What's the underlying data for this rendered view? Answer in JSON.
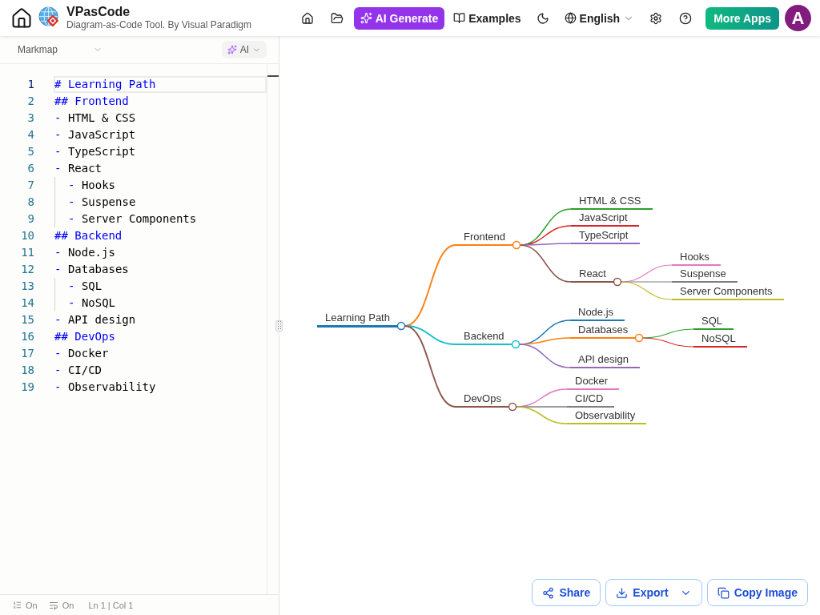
{
  "header": {
    "app_name": "VPasCode",
    "tagline": "Diagram-as-Code Tool. By Visual Paradigm",
    "ai_generate": "AI Generate",
    "examples": "Examples",
    "language": "English",
    "more_apps": "More Apps",
    "avatar": "A"
  },
  "editor": {
    "diagram_type": "Markmap",
    "ai_menu": "AI",
    "lines": [
      {
        "number": "1",
        "kind": "heading",
        "marker": "#",
        "text": "Learning Path",
        "selected": true
      },
      {
        "number": "2",
        "kind": "heading",
        "marker": "##",
        "text": "Frontend",
        "selected": false
      },
      {
        "number": "3",
        "kind": "item",
        "marker": "-",
        "text": "HTML & CSS",
        "selected": false
      },
      {
        "number": "4",
        "kind": "item",
        "marker": "-",
        "text": "JavaScript",
        "selected": false
      },
      {
        "number": "5",
        "kind": "item",
        "marker": "-",
        "text": "TypeScript",
        "selected": false
      },
      {
        "number": "6",
        "kind": "item",
        "marker": "-",
        "text": "React",
        "selected": false,
        "children": [
          {
            "number": "7",
            "kind": "item",
            "marker": "-",
            "text": "Hooks",
            "selected": false
          },
          {
            "number": "8",
            "kind": "item",
            "marker": "-",
            "text": "Suspense",
            "selected": false
          },
          {
            "number": "9",
            "kind": "item",
            "marker": "-",
            "text": "Server Components",
            "selected": false
          }
        ]
      },
      {
        "number": "10",
        "kind": "heading",
        "marker": "##",
        "text": "Backend",
        "selected": false
      },
      {
        "number": "11",
        "kind": "item",
        "marker": "-",
        "text": "Node.js",
        "selected": false
      },
      {
        "number": "12",
        "kind": "item",
        "marker": "-",
        "text": "Databases",
        "selected": false,
        "children": [
          {
            "number": "13",
            "kind": "item",
            "marker": "-",
            "text": "SQL",
            "selected": false
          },
          {
            "number": "14",
            "kind": "item",
            "marker": "-",
            "text": "NoSQL",
            "selected": false
          }
        ]
      },
      {
        "number": "15",
        "kind": "item",
        "marker": "-",
        "text": "API design",
        "selected": false
      },
      {
        "number": "16",
        "kind": "heading",
        "marker": "##",
        "text": "DevOps",
        "selected": false
      },
      {
        "number": "17",
        "kind": "item",
        "marker": "-",
        "text": "Docker",
        "selected": false
      },
      {
        "number": "18",
        "kind": "item",
        "marker": "-",
        "text": "CI/CD",
        "selected": false
      },
      {
        "number": "19",
        "kind": "item",
        "marker": "-",
        "text": "Observability",
        "selected": false
      }
    ],
    "status_bar": {
      "line_numbers": "On",
      "word_wrap": "On",
      "cursor": "Ln 1 | Col 1"
    }
  },
  "mindmap": {
    "label": "Learning Path",
    "color": "#1f77b4",
    "children": [
      {
        "label": "Frontend",
        "color": "#ff7f0e",
        "children": [
          {
            "label": "HTML & CSS",
            "color": "#2ca02c"
          },
          {
            "label": "JavaScript",
            "color": "#d62728"
          },
          {
            "label": "TypeScript",
            "color": "#9467bd"
          },
          {
            "label": "React",
            "color": "#8c564b",
            "children": [
              {
                "label": "Hooks",
                "color": "#e377c2"
              },
              {
                "label": "Suspense",
                "color": "#7f7f7f"
              },
              {
                "label": "Server Components",
                "color": "#bcbd22"
              }
            ]
          }
        ]
      },
      {
        "label": "Backend",
        "color": "#17becf",
        "children": [
          {
            "label": "Node.js",
            "color": "#1f77b4"
          },
          {
            "label": "Databases",
            "color": "#ff7f0e",
            "children": [
              {
                "label": "SQL",
                "color": "#2ca02c"
              },
              {
                "label": "NoSQL",
                "color": "#d62728"
              }
            ]
          },
          {
            "label": "API design",
            "color": "#9467bd"
          }
        ]
      },
      {
        "label": "DevOps",
        "color": "#8c564b",
        "children": [
          {
            "label": "Docker",
            "color": "#e377c2"
          },
          {
            "label": "CI/CD",
            "color": "#7f7f7f"
          },
          {
            "label": "Observability",
            "color": "#bcbd22"
          }
        ]
      }
    ]
  },
  "actions": {
    "share": "Share",
    "export": "Export",
    "copy_image": "Copy Image"
  }
}
